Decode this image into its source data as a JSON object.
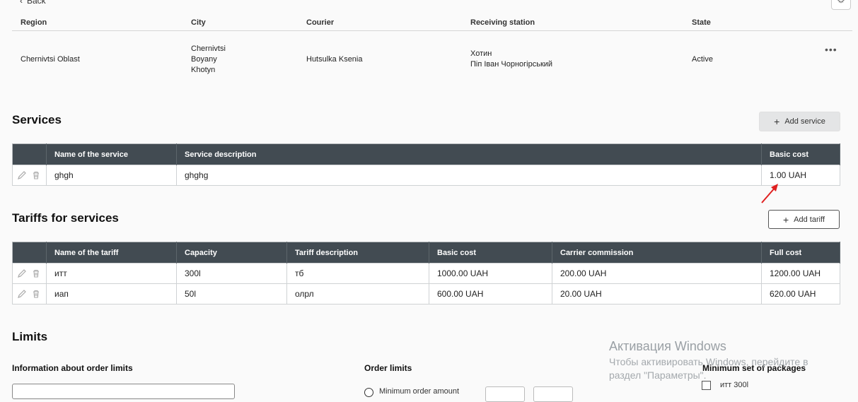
{
  "header": {
    "back_label": "Back",
    "columns": [
      "Region",
      "City",
      "Courier",
      "Receiving station",
      "State"
    ],
    "row": {
      "region": "Chernivtsi Oblast",
      "cities": [
        "Chernivtsi",
        "Boyany",
        "Khotyn"
      ],
      "courier": "Hutsulka Ksenia",
      "stations": [
        "Хотин",
        "Піп Іван Чорногірський"
      ],
      "state": "Active",
      "menu": "•••"
    }
  },
  "services": {
    "title": "Services",
    "add_label": "Add service",
    "columns": [
      "Name of the service",
      "Service description",
      "Basic cost"
    ],
    "rows": [
      {
        "name": "ghgh",
        "description": "ghghg",
        "cost": "1.00 UAH"
      }
    ]
  },
  "tariffs": {
    "title": "Tariffs for services",
    "add_label": "Add tariff",
    "columns": [
      "Name of the tariff",
      "Capacity",
      "Tariff description",
      "Basic cost",
      "Carrier commission",
      "Full cost"
    ],
    "rows": [
      {
        "name": "итт",
        "capacity": "300l",
        "description": "тб",
        "basic": "1000.00 UAH",
        "commission": "200.00 UAH",
        "full": "1200.00 UAH"
      },
      {
        "name": "иап",
        "capacity": "50l",
        "description": "олрл",
        "basic": "600.00 UAH",
        "commission": "20.00 UAH",
        "full": "620.00 UAH"
      }
    ]
  },
  "limits": {
    "title": "Limits",
    "info_label": "Information about order limits",
    "order_limits_label": "Order limits",
    "min_order_label": "Minimum order amount",
    "min_packages_label": "Minimum set of packages",
    "package_item": "итт 300l"
  },
  "watermark": {
    "title": "Активация Windows",
    "line1": "Чтобы активировать Windows, перейдите в",
    "line2": "раздел \"Параметры\"."
  },
  "colors": {
    "table_header": "#424b52",
    "annotation_arrow": "#e02020"
  }
}
